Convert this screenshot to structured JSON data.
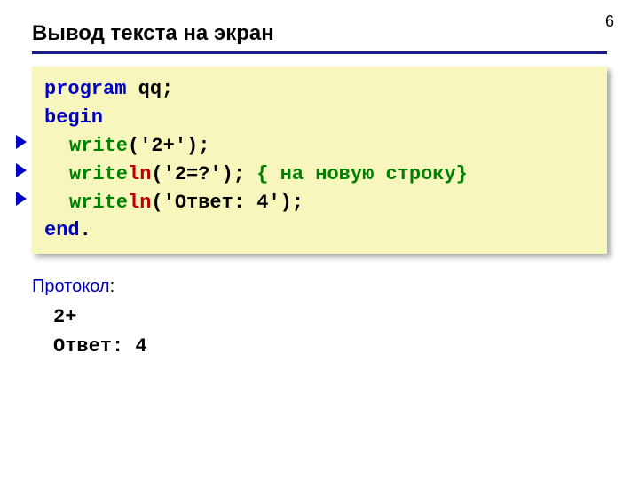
{
  "page_number": "6",
  "title": "Вывод текста на экран",
  "code": {
    "l1": {
      "kw": "program",
      "rest": " qq;"
    },
    "l2": {
      "kw": "begin"
    },
    "l3": {
      "fn": "write",
      "args": "('2+');"
    },
    "l4": {
      "fn": "write",
      "ln": "ln",
      "args": "('2=?'); ",
      "comment": "{ на новую строку}"
    },
    "l5": {
      "fn": "write",
      "ln": "ln",
      "args": "('Ответ: 4');"
    },
    "l6": {
      "kw": "end",
      "rest": "."
    }
  },
  "protocol": {
    "label": "Протокол",
    "colon": ":",
    "lines": [
      "2+",
      "Ответ: 4"
    ]
  }
}
